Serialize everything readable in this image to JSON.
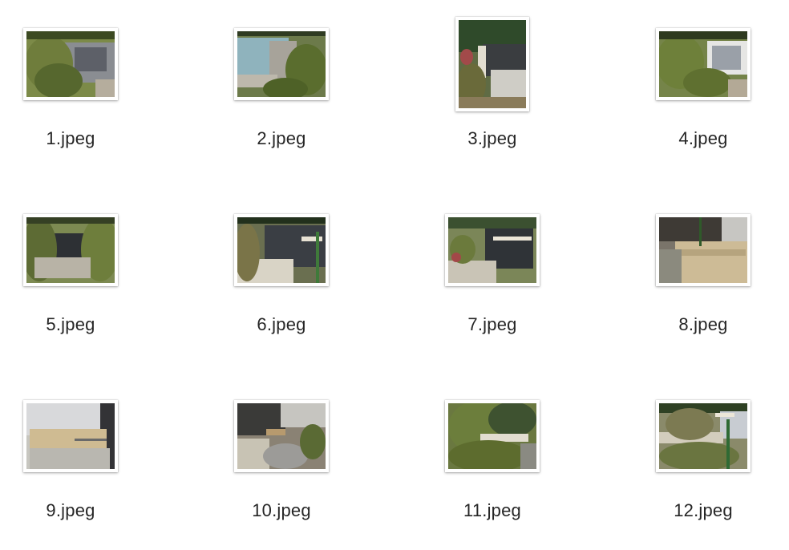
{
  "files": [
    {
      "name": "1.jpeg",
      "orientation": "landscape",
      "scene": "garden-wall"
    },
    {
      "name": "2.jpeg",
      "orientation": "landscape",
      "scene": "blue-wall-shed"
    },
    {
      "name": "3.jpeg",
      "orientation": "portrait",
      "scene": "fence-path"
    },
    {
      "name": "4.jpeg",
      "orientation": "landscape",
      "scene": "garden-fence"
    },
    {
      "name": "5.jpeg",
      "orientation": "landscape",
      "scene": "dark-fence-trees"
    },
    {
      "name": "6.jpeg",
      "orientation": "landscape",
      "scene": "dark-fence-pipe"
    },
    {
      "name": "7.jpeg",
      "orientation": "landscape",
      "scene": "fence-corridor"
    },
    {
      "name": "8.jpeg",
      "orientation": "landscape",
      "scene": "wood-planks"
    },
    {
      "name": "9.jpeg",
      "orientation": "landscape",
      "scene": "wood-box-wall"
    },
    {
      "name": "10.jpeg",
      "orientation": "landscape",
      "scene": "debris-bag"
    },
    {
      "name": "11.jpeg",
      "orientation": "landscape",
      "scene": "bushes"
    },
    {
      "name": "12.jpeg",
      "orientation": "landscape",
      "scene": "garden-pipe"
    }
  ]
}
